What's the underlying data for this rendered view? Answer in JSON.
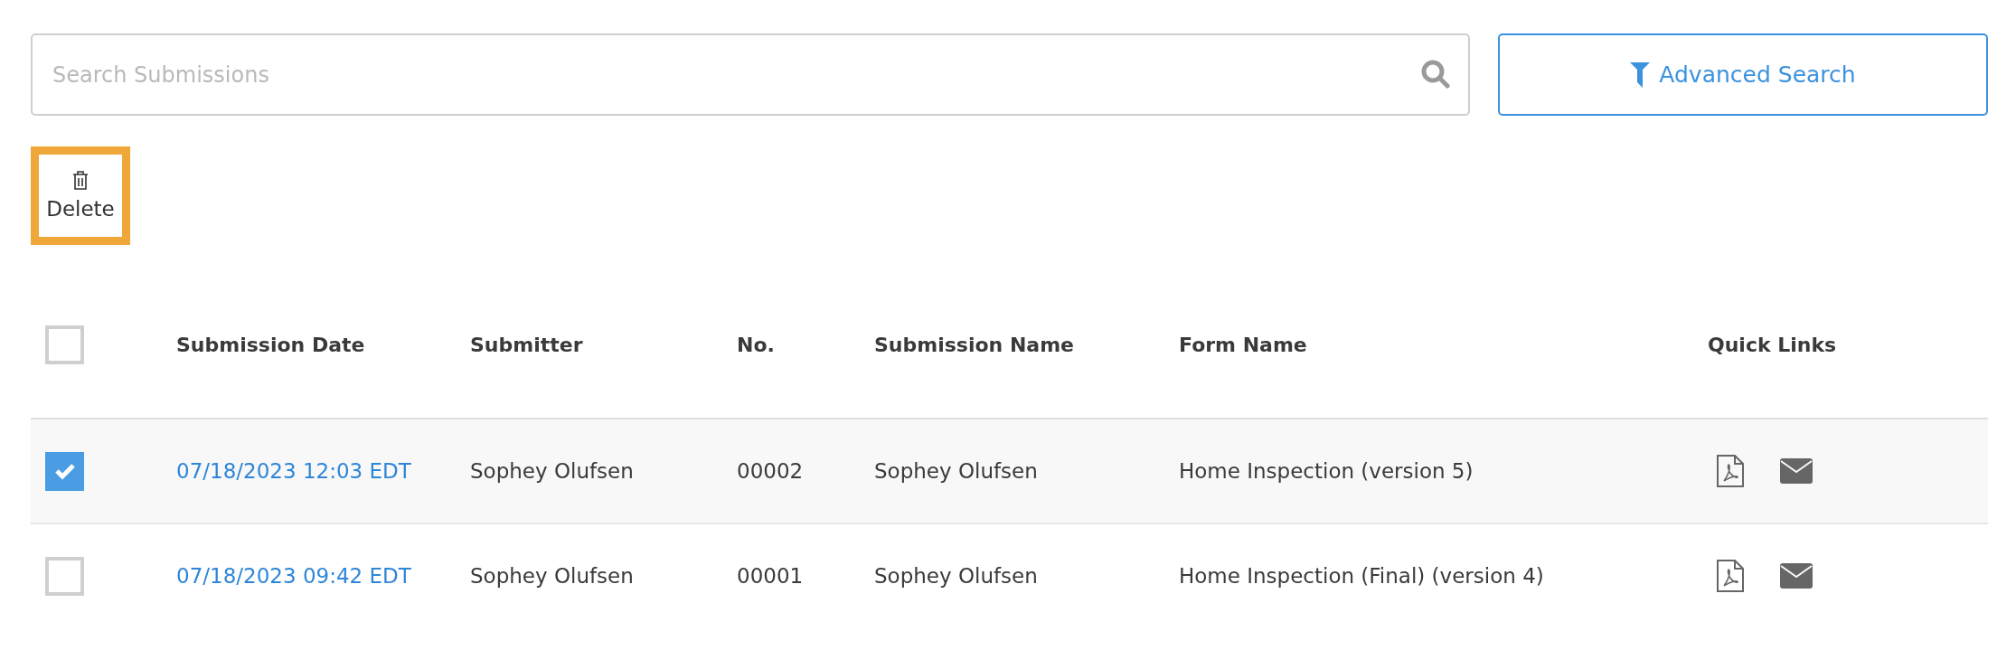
{
  "search": {
    "placeholder": "Search Submissions"
  },
  "advanced_search": {
    "label": "Advanced Search"
  },
  "toolbar": {
    "delete": {
      "label": "Delete",
      "highlighted": true
    }
  },
  "table": {
    "select_all": {
      "checked": false
    },
    "columns": [
      "Submission Date",
      "Submitter",
      "No.",
      "Submission Name",
      "Form Name",
      "Quick Links"
    ],
    "rows": [
      {
        "selected": true,
        "date": "07/18/2023 12:03 EDT",
        "submitter": "Sophey Olufsen",
        "no": "00002",
        "submission_name": "Sophey Olufsen",
        "form_name": "Home Inspection (version 5)"
      },
      {
        "selected": false,
        "date": "07/18/2023 09:42 EDT",
        "submitter": "Sophey Olufsen",
        "no": "00001",
        "submission_name": "Sophey Olufsen",
        "form_name": "Home Inspection (Final) (version 4)"
      }
    ]
  }
}
